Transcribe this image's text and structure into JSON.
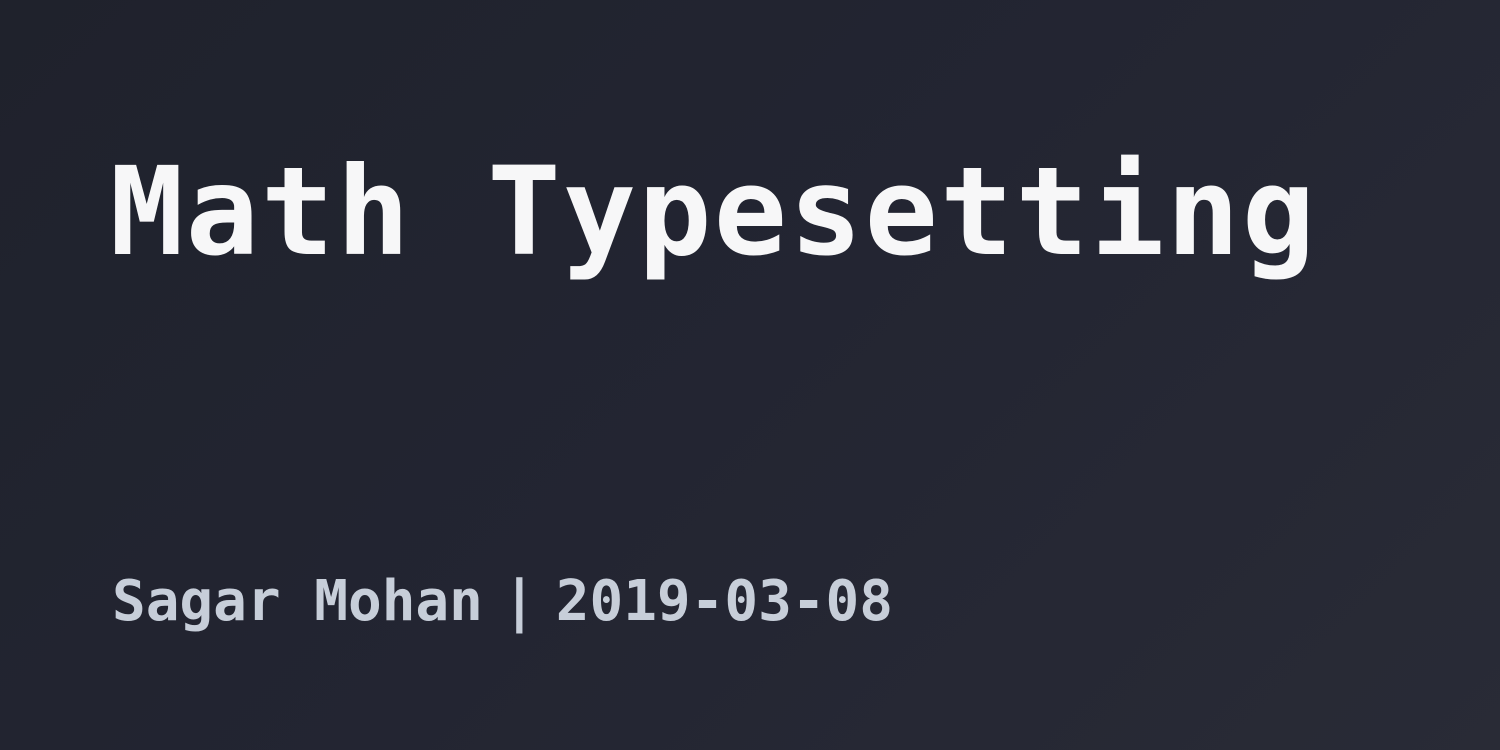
{
  "title": "Math Typesetting",
  "byline": {
    "author": "Sagar Mohan",
    "separator": "|",
    "date": "2019-03-08"
  },
  "colors": {
    "background": "#232532",
    "title": "#f7f7f8",
    "byline": "#c7ced9"
  }
}
